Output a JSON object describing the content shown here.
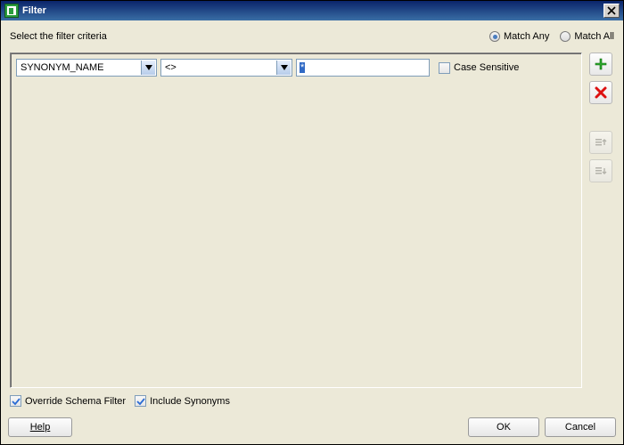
{
  "window": {
    "title": "Filter"
  },
  "instruction": "Select the filter criteria",
  "match_mode": {
    "any_label": "Match Any",
    "all_label": "Match All",
    "selected": "any"
  },
  "criteria": [
    {
      "field": "SYNONYM_NAME",
      "operator": "<>",
      "value": "*",
      "case_sensitive": false
    }
  ],
  "labels": {
    "case_sensitive": "Case Sensitive",
    "override_schema": "Override Schema Filter",
    "include_synonyms": "Include Synonyms"
  },
  "options": {
    "override_schema": true,
    "include_synonyms": true
  },
  "buttons": {
    "help": "Help",
    "ok": "OK",
    "cancel": "Cancel"
  },
  "tools": {
    "add": "add-icon",
    "remove": "remove-icon",
    "move_up": "move-up-icon",
    "move_down": "move-down-icon"
  }
}
